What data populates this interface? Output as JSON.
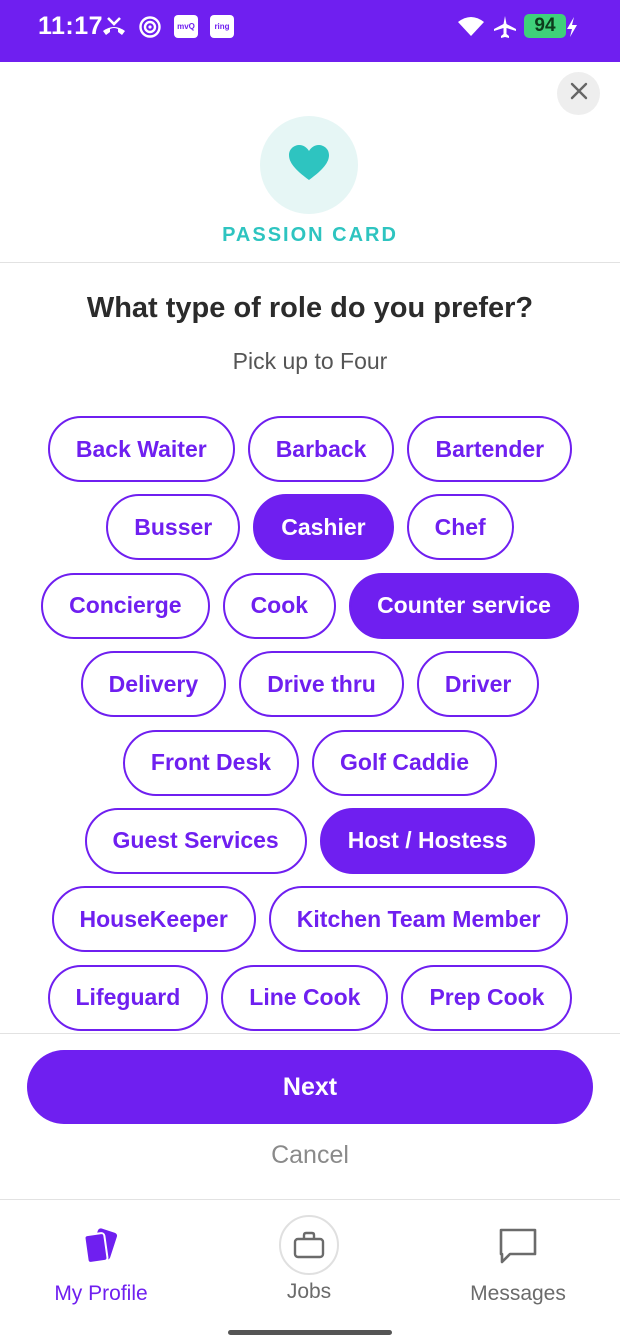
{
  "status_bar": {
    "time": "11:17",
    "battery": "94",
    "notification_icons": [
      "missed-call-icon",
      "target-icon",
      "mq-app-icon",
      "ring-app-icon"
    ],
    "mq_badge": "mvQ",
    "ring_badge": "ring",
    "system_icons": [
      "wifi-icon",
      "airplane-icon",
      "battery-icon",
      "charging-icon"
    ]
  },
  "header": {
    "card_label": "PASSION CARD",
    "card_icon": "heart-icon",
    "close_icon": "close-icon"
  },
  "question": {
    "title": "What type of role do you prefer?",
    "subtitle": "Pick up to Four"
  },
  "roles": [
    [
      {
        "label": "Back Waiter",
        "selected": false
      },
      {
        "label": "Barback",
        "selected": false
      },
      {
        "label": "Bartender",
        "selected": false
      }
    ],
    [
      {
        "label": "Busser",
        "selected": false
      },
      {
        "label": "Cashier",
        "selected": true
      },
      {
        "label": "Chef",
        "selected": false
      }
    ],
    [
      {
        "label": "Concierge",
        "selected": false
      },
      {
        "label": "Cook",
        "selected": false
      },
      {
        "label": "Counter service",
        "selected": true
      }
    ],
    [
      {
        "label": "Delivery",
        "selected": false
      },
      {
        "label": "Drive thru",
        "selected": false
      },
      {
        "label": "Driver",
        "selected": false
      }
    ],
    [
      {
        "label": "Front Desk",
        "selected": false
      },
      {
        "label": "Golf Caddie",
        "selected": false
      }
    ],
    [
      {
        "label": "Guest Services",
        "selected": false
      },
      {
        "label": "Host / Hostess",
        "selected": true
      }
    ],
    [
      {
        "label": "HouseKeeper",
        "selected": false
      },
      {
        "label": "Kitchen Team Member",
        "selected": false
      }
    ],
    [
      {
        "label": "Lifeguard",
        "selected": false
      },
      {
        "label": "Line Cook",
        "selected": false
      },
      {
        "label": "Prep Cook",
        "selected": false
      }
    ]
  ],
  "actions": {
    "next_label": "Next",
    "cancel_label": "Cancel"
  },
  "bottom_nav": {
    "items": [
      {
        "label": "My Profile",
        "icon": "cards-icon",
        "active": true
      },
      {
        "label": "Jobs",
        "icon": "briefcase-icon",
        "active": false
      },
      {
        "label": "Messages",
        "icon": "message-icon",
        "active": false
      }
    ]
  },
  "colors": {
    "brand": "#6f1ff0",
    "accent": "#2ec4c0",
    "battery": "#3fd07a"
  }
}
